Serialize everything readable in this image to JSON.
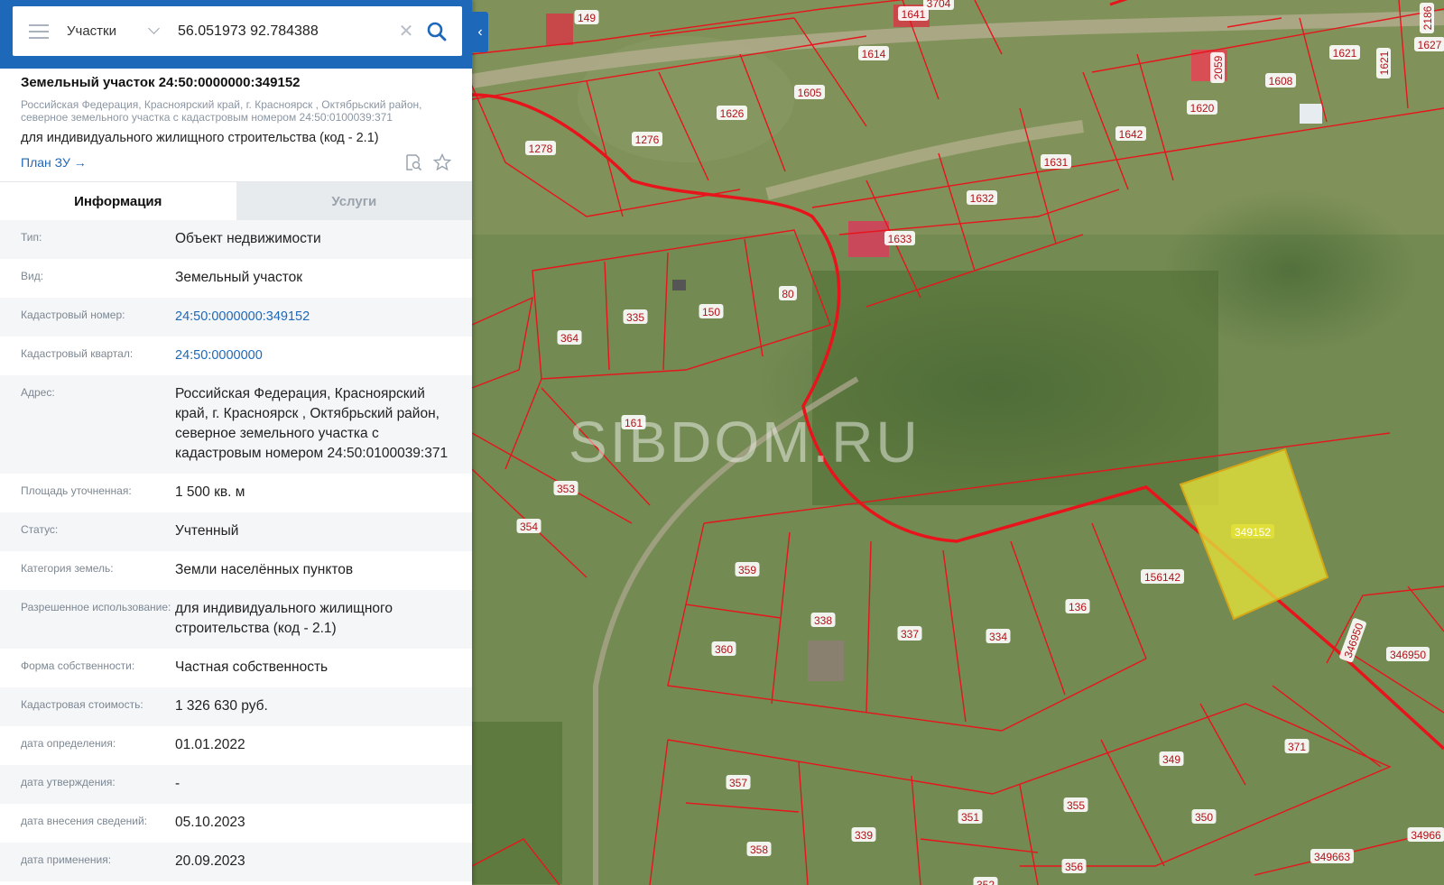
{
  "search": {
    "type": "Участки",
    "query": "56.051973 92.784388"
  },
  "object": {
    "title": "Земельный участок 24:50:0000000:349152",
    "address_short": "Российская Федерация, Красноярский край, г. Красноярск , Октябрьский район, северное земельного участка с кадастровым номером 24:50:0100039:371",
    "use": "для индивидуального жилищного строительства (код - 2.1)",
    "plan_link": "План ЗУ →"
  },
  "tabs": [
    {
      "label": "Информация"
    },
    {
      "label": "Услуги"
    }
  ],
  "info_rows": [
    {
      "label": "Тип:",
      "value": "Объект недвижимости"
    },
    {
      "label": "Вид:",
      "value": "Земельный участок"
    },
    {
      "label": "Кадастровый номер:",
      "value": "24:50:0000000:349152"
    },
    {
      "label": "Кадастровый квартал:",
      "value": "24:50:0000000"
    },
    {
      "label": "Адрес:",
      "value": "Российская Федерация, Красноярский край, г. Красноярск , Октябрьский район, северное земельного участка с кадастровым номером 24:50:0100039:371"
    },
    {
      "label": "Площадь уточненная:",
      "value": "1 500 кв. м"
    },
    {
      "label": "Статус:",
      "value": "Учтенный"
    },
    {
      "label": "Категория земель:",
      "value": "Земли населённых пунктов"
    },
    {
      "label": "Разрешенное использование:",
      "value": "для индивидуального жилищного строительства (код - 2.1)"
    },
    {
      "label": "Форма собственности:",
      "value": "Частная собственность"
    },
    {
      "label": "Кадастровая стоимость:",
      "value": "1 326 630 руб."
    },
    {
      "label": "дата определения:",
      "value": "01.01.2022"
    },
    {
      "label": "дата утверждения:",
      "value": "-"
    },
    {
      "label": "дата внесения сведений:",
      "value": "05.10.2023"
    },
    {
      "label": "дата применения:",
      "value": "20.09.2023"
    }
  ],
  "map": {
    "watermark": "SIBDOM.RU",
    "parcel_labels": [
      "149",
      "1641",
      "3704",
      "2186",
      "1614",
      "1605",
      "1626",
      "1276",
      "1278",
      "1620",
      "2059",
      "1608",
      "1621",
      "1621",
      "1627",
      "1642",
      "1631",
      "1632",
      "1633",
      "364",
      "335",
      "150",
      "80",
      "161",
      "353",
      "354",
      "359",
      "338",
      "337",
      "334",
      "136",
      "156142",
      "349152",
      "360",
      "346950",
      "346950",
      "371",
      "349",
      "357",
      "351",
      "355",
      "350",
      "339",
      "358",
      "356",
      "349663",
      "34966",
      "352"
    ],
    "highlight_color": "#e2e03a",
    "boundary_color": "#e8141c"
  }
}
